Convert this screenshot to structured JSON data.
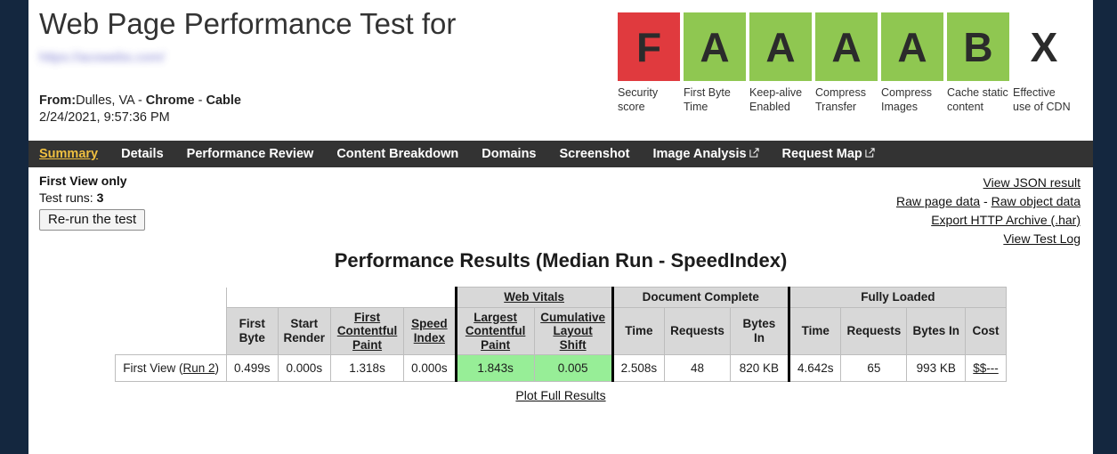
{
  "header": {
    "title": "Web Page Performance Test for",
    "url_blurred": "https://acowebs.com/",
    "from_label": "From:",
    "from_value": "Dulles, VA - ",
    "browser": "Chrome",
    "dash": " - ",
    "connection": "Cable",
    "timestamp": "2/24/2021, 9:57:36 PM"
  },
  "grades": [
    {
      "letter": "F",
      "label": "Security score",
      "color": "#e03a3e",
      "tone": "red"
    },
    {
      "letter": "A",
      "label": "First Byte Time",
      "color": "#8fc751",
      "tone": "green"
    },
    {
      "letter": "A",
      "label": "Keep-alive Enabled",
      "color": "#8fc751",
      "tone": "green"
    },
    {
      "letter": "A",
      "label": "Compress Transfer",
      "color": "#8fc751",
      "tone": "green"
    },
    {
      "letter": "A",
      "label": "Compress Images",
      "color": "#8fc751",
      "tone": "green"
    },
    {
      "letter": "B",
      "label": "Cache static content",
      "color": "#8fc751",
      "tone": "green"
    },
    {
      "letter": "X",
      "label": "Effective use of CDN",
      "color": "#ffffff",
      "tone": "none"
    }
  ],
  "nav": {
    "active": "Summary",
    "items": [
      {
        "label": "Summary",
        "active": true,
        "external": false
      },
      {
        "label": "Details",
        "active": false,
        "external": false
      },
      {
        "label": "Performance Review",
        "active": false,
        "external": false
      },
      {
        "label": "Content Breakdown",
        "active": false,
        "external": false
      },
      {
        "label": "Domains",
        "active": false,
        "external": false
      },
      {
        "label": "Screenshot",
        "active": false,
        "external": false
      },
      {
        "label": "Image Analysis",
        "active": false,
        "external": true
      },
      {
        "label": "Request Map",
        "active": false,
        "external": true
      }
    ]
  },
  "subbar": {
    "first_view_only": "First View only",
    "test_runs_label": "Test runs:",
    "test_runs_value": "3",
    "rerun_button": "Re-run the test",
    "links": {
      "view_json": "View JSON result",
      "raw_page": "Raw page data",
      "separator": " - ",
      "raw_object": "Raw object data",
      "export_har": "Export HTTP Archive (.har)",
      "view_log": "View Test Log"
    }
  },
  "results": {
    "title": "Performance Results (Median Run - SpeedIndex)",
    "group_headers": {
      "web_vitals": "Web Vitals",
      "document_complete": "Document Complete",
      "fully_loaded": "Fully Loaded"
    },
    "columns": {
      "first_byte": "First Byte",
      "start_render": "Start Render",
      "first_contentful_paint": "First Contentful Paint",
      "speed_index": "Speed Index",
      "largest_contentful_paint": "Largest Contentful Paint",
      "cumulative_layout_shift": "Cumulative Layout Shift",
      "dc_time": "Time",
      "dc_requests": "Requests",
      "dc_bytes_in": "Bytes In",
      "fl_time": "Time",
      "fl_requests": "Requests",
      "fl_bytes_in": "Bytes In",
      "fl_cost": "Cost"
    },
    "row": {
      "label_prefix": "First View (",
      "label_link": "Run 2",
      "label_suffix": ")",
      "first_byte": "0.499s",
      "start_render": "0.000s",
      "first_contentful_paint": "1.318s",
      "speed_index": "0.000s",
      "largest_contentful_paint": "1.843s",
      "cumulative_layout_shift": "0.005",
      "dc_time": "2.508s",
      "dc_requests": "48",
      "dc_bytes_in": "820 KB",
      "fl_time": "4.642s",
      "fl_requests": "65",
      "fl_bytes_in": "993 KB",
      "fl_cost": "$$---"
    },
    "plot_link": "Plot Full Results"
  }
}
